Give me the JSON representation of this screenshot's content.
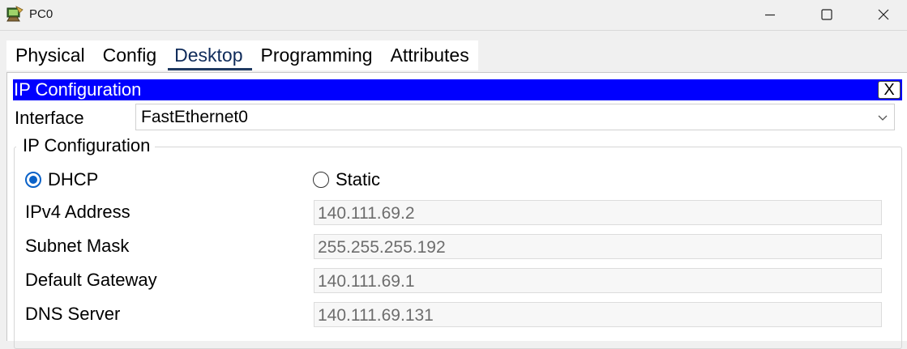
{
  "window": {
    "title": "PC0",
    "controls": {
      "minimize": "minimize",
      "maximize": "maximize",
      "close": "close"
    }
  },
  "tabs": [
    "Physical",
    "Config",
    "Desktop",
    "Programming",
    "Attributes"
  ],
  "active_tab": "Desktop",
  "ip_config": {
    "header_title": "IP Configuration",
    "close_label": "X",
    "interface_label": "Interface",
    "interface_value": "FastEthernet0",
    "group_title": "IP Configuration",
    "dhcp_label": "DHCP",
    "static_label": "Static",
    "selected_mode": "DHCP",
    "ipv4_label": "IPv4 Address",
    "ipv4_value": "140.111.69.2",
    "subnet_label": "Subnet Mask",
    "subnet_value": "255.255.255.192",
    "gateway_label": "Default Gateway",
    "gateway_value": "140.111.69.1",
    "dns_label": "DNS Server",
    "dns_value": "140.111.69.131"
  },
  "colors": {
    "header_bg": "#0000ff",
    "radio_accent": "#0a62c8",
    "active_tab_underline": "#1f3a62"
  },
  "icons": {
    "app": "packet-tracer-pc-icon",
    "dropdown": "chevron-down-icon"
  }
}
